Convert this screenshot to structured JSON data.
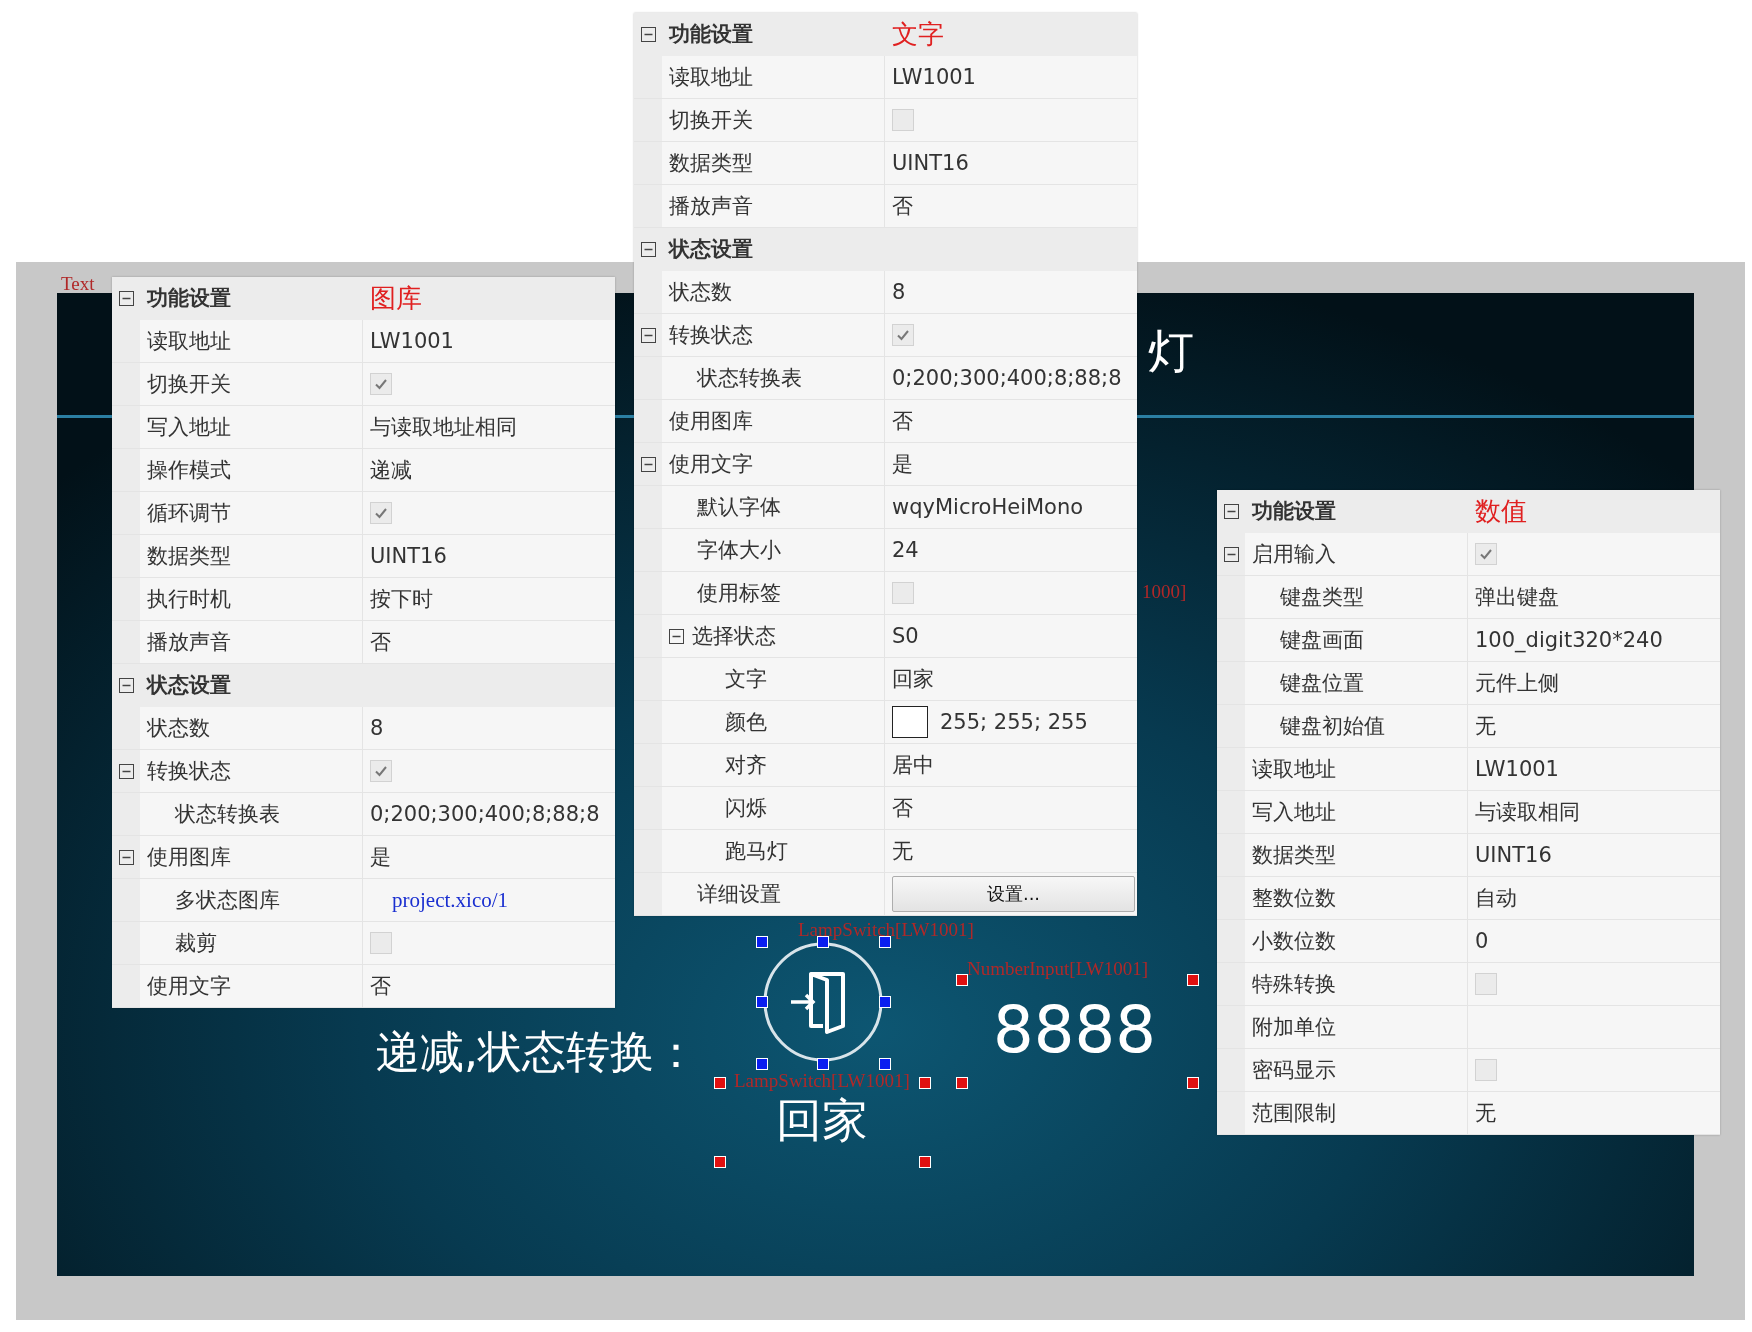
{
  "panels": [
    {
      "sections": [
        {
          "title": "功能设置",
          "tag": "图库",
          "expanded": true,
          "rows": [
            {
              "label": "读取地址",
              "kind": "text",
              "value": "LW1001"
            },
            {
              "label": "切换开关",
              "kind": "checkbox",
              "checked": true
            },
            {
              "label": "写入地址",
              "kind": "text",
              "value": "与读取地址相同"
            },
            {
              "label": "操作模式",
              "kind": "text",
              "value": "递减"
            },
            {
              "label": "循环调节",
              "kind": "checkbox",
              "checked": true
            },
            {
              "label": "数据类型",
              "kind": "text",
              "value": "UINT16"
            },
            {
              "label": "执行时机",
              "kind": "text",
              "value": "按下时"
            },
            {
              "label": "播放声音",
              "kind": "text",
              "value": "否"
            }
          ]
        },
        {
          "title": "状态设置",
          "expanded": true,
          "rows": [
            {
              "label": "状态数",
              "kind": "text",
              "value": "8"
            },
            {
              "label": "转换状态",
              "kind": "checkbox",
              "checked": true,
              "expanded": true,
              "children": [
                {
                  "label": "状态转换表",
                  "kind": "text",
                  "value": "0;200;300;400;8;88;8"
                }
              ]
            },
            {
              "label": "使用图库",
              "kind": "text",
              "value": "是",
              "expanded": true,
              "children": [
                {
                  "label": "多状态图库",
                  "kind": "link",
                  "value": "project.xico/1"
                },
                {
                  "label": "裁剪",
                  "kind": "checkbox",
                  "checked": false
                }
              ]
            },
            {
              "label": "使用文字",
              "kind": "text",
              "value": "否"
            }
          ]
        }
      ]
    },
    {
      "sections": [
        {
          "title": "功能设置",
          "tag": "文字",
          "expanded": true,
          "rows": [
            {
              "label": "读取地址",
              "kind": "text",
              "value": "LW1001"
            },
            {
              "label": "切换开关",
              "kind": "checkbox",
              "checked": false
            },
            {
              "label": "数据类型",
              "kind": "text",
              "value": "UINT16"
            },
            {
              "label": "播放声音",
              "kind": "text",
              "value": "否"
            }
          ]
        },
        {
          "title": "状态设置",
          "expanded": true,
          "rows": [
            {
              "label": "状态数",
              "kind": "text",
              "value": "8"
            },
            {
              "label": "转换状态",
              "kind": "checkbox",
              "checked": true,
              "expanded": true,
              "children": [
                {
                  "label": "状态转换表",
                  "kind": "text",
                  "value": "0;200;300;400;8;88;8"
                }
              ]
            },
            {
              "label": "使用图库",
              "kind": "text",
              "value": "否"
            },
            {
              "label": "使用文字",
              "kind": "text",
              "value": "是",
              "expanded": true,
              "children": [
                {
                  "label": "默认字体",
                  "kind": "text",
                  "value": "wqyMicroHeiMono"
                },
                {
                  "label": "字体大小",
                  "kind": "text",
                  "value": "24"
                },
                {
                  "label": "使用标签",
                  "kind": "checkbox",
                  "checked": false
                },
                {
                  "label": "选择状态",
                  "kind": "text",
                  "value": "S0",
                  "expanded": true,
                  "children": [
                    {
                      "label": "文字",
                      "kind": "text",
                      "value": "回家"
                    },
                    {
                      "label": "颜色",
                      "kind": "color",
                      "color": "#ffffff",
                      "value": "255; 255; 255"
                    },
                    {
                      "label": "对齐",
                      "kind": "text",
                      "value": "居中"
                    },
                    {
                      "label": "闪烁",
                      "kind": "text",
                      "value": "否"
                    },
                    {
                      "label": "跑马灯",
                      "kind": "text",
                      "value": "无"
                    }
                  ]
                },
                {
                  "label": "详细设置",
                  "kind": "button",
                  "value": "设置..."
                }
              ]
            }
          ]
        }
      ]
    },
    {
      "sections": [
        {
          "title": "功能设置",
          "tag": "数值",
          "expanded": true,
          "rows": [
            {
              "label": "启用输入",
              "kind": "checkbox",
              "checked": true,
              "expanded": true,
              "children": [
                {
                  "label": "键盘类型",
                  "kind": "text",
                  "value": "弹出键盘"
                },
                {
                  "label": "键盘画面",
                  "kind": "text",
                  "value": "100_digit320*240"
                },
                {
                  "label": "键盘位置",
                  "kind": "text",
                  "value": "元件上侧"
                },
                {
                  "label": "键盘初始值",
                  "kind": "text",
                  "value": "无"
                }
              ]
            },
            {
              "label": "读取地址",
              "kind": "text",
              "value": "LW1001"
            },
            {
              "label": "写入地址",
              "kind": "text",
              "value": "与读取相同"
            },
            {
              "label": "数据类型",
              "kind": "text",
              "value": "UINT16"
            },
            {
              "label": "整数位数",
              "kind": "text",
              "value": "自动"
            },
            {
              "label": "小数位数",
              "kind": "text",
              "value": "0"
            },
            {
              "label": "特殊转换",
              "kind": "checkbox",
              "checked": false
            },
            {
              "label": "附加单位",
              "kind": "text"
            },
            {
              "label": "密码显示",
              "kind": "checkbox",
              "checked": false
            },
            {
              "label": "范围限制",
              "kind": "text",
              "value": "无"
            }
          ]
        }
      ]
    }
  ],
  "canvas": {
    "corner_tag": "Text",
    "title_fragment": "灯",
    "label_fragment": "1000]",
    "caption": "递减,状态转换：",
    "lamp_switch": {
      "top_label": "LampSwitch[LW1001]",
      "bottom_label": "LampSwitch[LW1001]",
      "text": "回家"
    },
    "number_input": {
      "label": "NumberInput[LW1001]",
      "value": "8888"
    }
  }
}
